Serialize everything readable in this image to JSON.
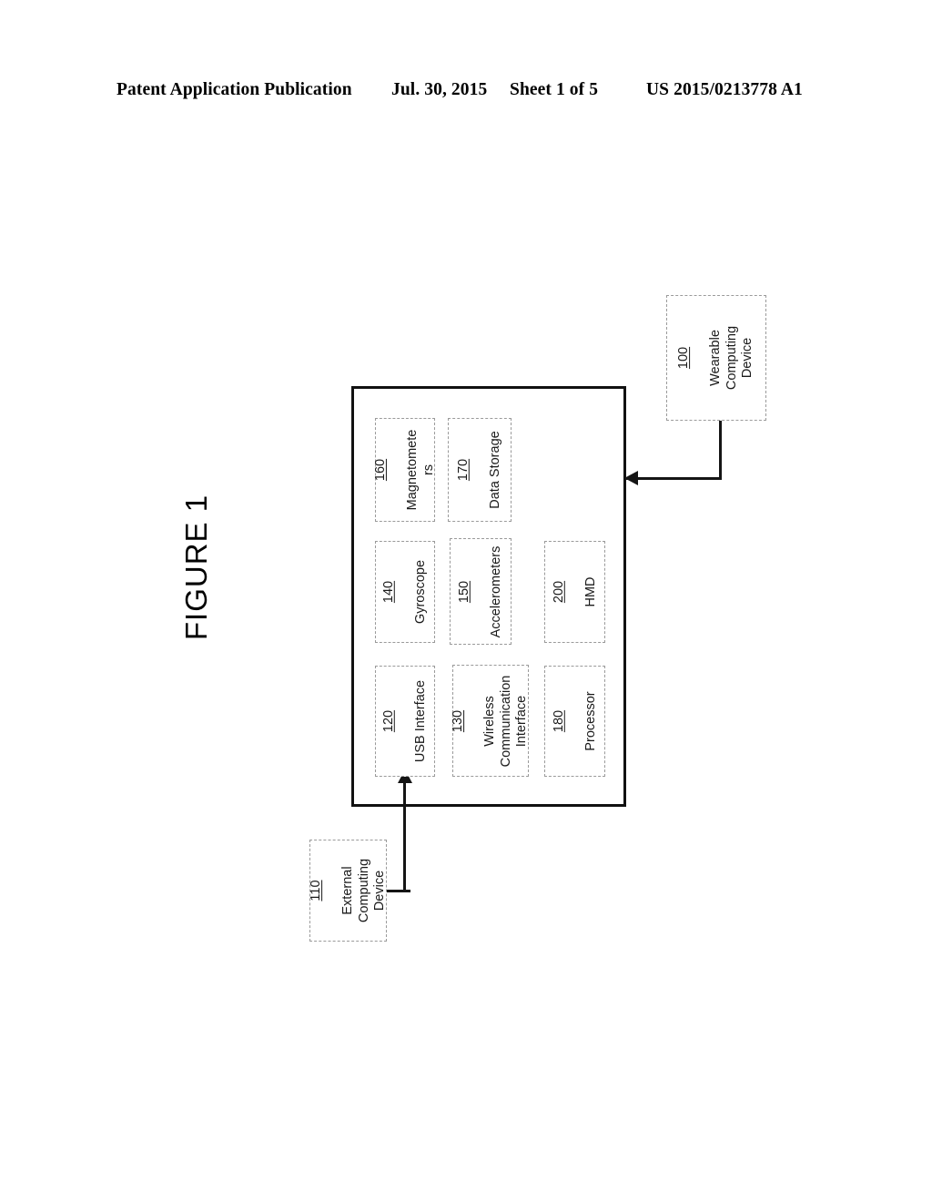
{
  "header": {
    "publication": "Patent Application Publication",
    "date": "Jul. 30, 2015",
    "sheet": "Sheet 1 of 5",
    "number": "US 2015/0213778 A1"
  },
  "figure": {
    "caption": "FIGURE 1"
  },
  "diagram": {
    "enclosure_ref": "100",
    "nodes": [
      {
        "ref": "160",
        "text": "Magnetomete\nrs"
      },
      {
        "ref": "170",
        "text": "Data Storage"
      },
      {
        "ref": "140",
        "text": "Gyroscope"
      },
      {
        "ref": "150",
        "text": "Accelerometers"
      },
      {
        "ref": "200",
        "text": "HMD"
      },
      {
        "ref": "120",
        "text": "USB Interface"
      },
      {
        "ref": "130",
        "text": "Wireless\nCommunication\nInterface"
      },
      {
        "ref": "180",
        "text": "Processor"
      },
      {
        "ref": "100",
        "text": "Wearable\nComputing\nDevice"
      },
      {
        "ref": "110",
        "text": "External\nComputing\nDevice"
      }
    ]
  },
  "colors": {
    "ink": "#000000",
    "box_border": "#9a9a9a",
    "enclosure_border": "#111111",
    "connector": "#151515",
    "background": "#ffffff"
  }
}
